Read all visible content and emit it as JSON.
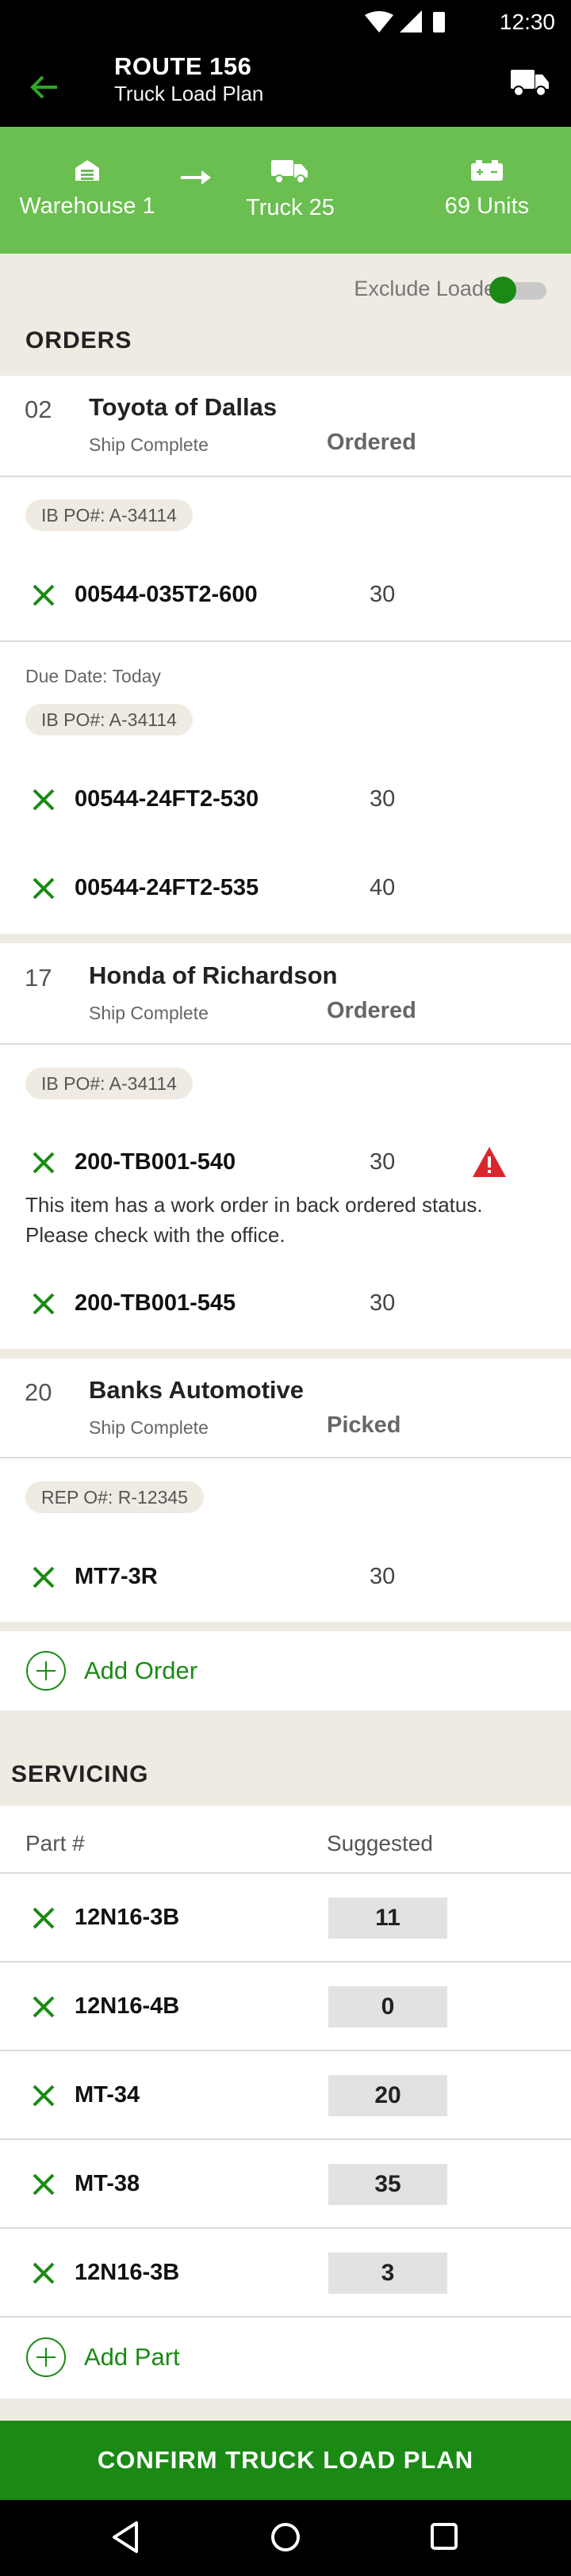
{
  "status_bar": {
    "time": "12:30"
  },
  "header": {
    "title": "ROUTE 156",
    "subtitle": "Truck Load Plan"
  },
  "summary": {
    "from": "Warehouse 1",
    "to": "Truck 25",
    "units": "69 Units"
  },
  "filter": {
    "label": "Exclude Loaded",
    "on": true
  },
  "orders": {
    "section_title": "ORDERS",
    "list": [
      {
        "number": "02",
        "customer": "Toyota of Dallas",
        "ship": "Ship Complete",
        "status": "Ordered",
        "groups": [
          {
            "due": "",
            "chip": "IB PO#: A-34114",
            "parts": [
              {
                "id": "00544-035T2-600",
                "qty": "30"
              }
            ]
          },
          {
            "due": "Due Date: Today",
            "chip": "IB PO#: A-34114",
            "parts": [
              {
                "id": "00544-24FT2-530",
                "qty": "30"
              },
              {
                "id": "00544-24FT2-535",
                "qty": "40"
              }
            ]
          }
        ]
      },
      {
        "number": "17",
        "customer": "Honda of Richardson",
        "ship": "Ship Complete",
        "status": "Ordered",
        "chip": "IB PO#: A-34114",
        "parts": [
          {
            "id": "200-TB001-540",
            "qty": "30",
            "warning": "This item has a work order in back ordered status. Please check with the office."
          },
          {
            "id": "200-TB001-545",
            "qty": "30"
          }
        ]
      },
      {
        "number": "20",
        "customer": "Banks Automotive",
        "ship": "Ship Complete",
        "status": "Picked",
        "chip": "REP O#: R-12345",
        "parts": [
          {
            "id": "MT7-3R",
            "qty": "30"
          }
        ]
      }
    ],
    "add_label": "Add Order"
  },
  "servicing": {
    "section_title": "SERVICING",
    "col_part": "Part #",
    "col_suggested": "Suggested",
    "parts": [
      {
        "id": "12N16-3B",
        "suggested": "11"
      },
      {
        "id": "12N16-4B",
        "suggested": "0"
      },
      {
        "id": "MT-34",
        "suggested": "20"
      },
      {
        "id": "MT-38",
        "suggested": "35"
      },
      {
        "id": "12N16-3B",
        "suggested": "3"
      }
    ],
    "add_label": "Add Part"
  },
  "confirm_label": "CONFIRM TRUCK LOAD PLAN",
  "colors": {
    "brand_green": "#1a8a14",
    "banner_green": "#6abf50",
    "warning_red": "#d9262c",
    "section_bg": "#efebe3"
  },
  "icons": [
    "back-arrow-icon",
    "truck-icon",
    "warehouse-icon",
    "arrow-right-icon",
    "battery-icon",
    "remove-x-icon",
    "warning-icon",
    "add-circle-icon"
  ]
}
